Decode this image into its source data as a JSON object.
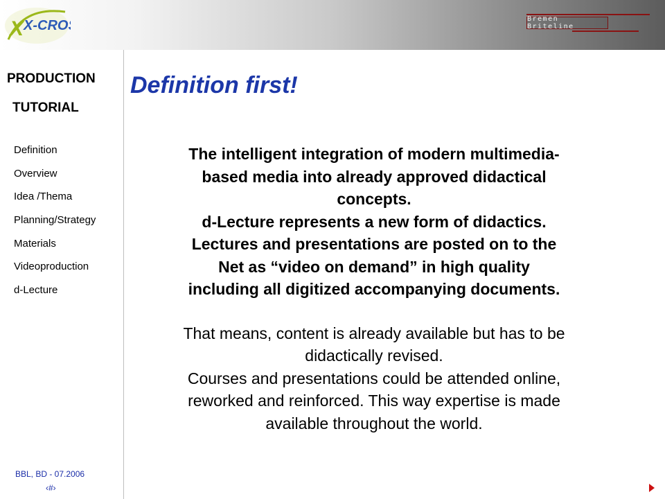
{
  "header": {
    "logo_text": "X-CROSS",
    "brand_text": "Bremen Briteline",
    "colors": {
      "logo_green": "#9bb81a",
      "logo_blue": "#2d5bb8",
      "brand_red": "#8a1212"
    }
  },
  "sidebar": {
    "title_line1": "PRODUCTION",
    "title_line2": "TUTORIAL",
    "items": [
      {
        "label": "Definition"
      },
      {
        "label": "Overview"
      },
      {
        "label": "Idea /Thema"
      },
      {
        "label": "Planning/Strategy"
      },
      {
        "label": "Materials"
      },
      {
        "label": "Videoproduction"
      },
      {
        "label": "d-Lecture"
      }
    ],
    "footer_credit": "BBL, BD - 07.2006",
    "page_number": "‹#›"
  },
  "slide": {
    "title": "Definition first!",
    "title_color": "#1c37a8",
    "bold_lines": [
      "The intelligent integration of modern multimedia-",
      "based media into already approved didactical",
      "concepts.",
      "d-Lecture represents a new form of didactics.",
      "Lectures and presentations are posted on to the",
      "Net as “video on demand” in high quality",
      "including all digitized accompanying documents."
    ],
    "normal_lines": [
      "That means, content is already available but has to be",
      "didactically revised.",
      "Courses and presentations could be attended online,",
      "reworked and reinforced. This way expertise is made",
      "available throughout the world."
    ]
  },
  "navigation": {
    "next_icon": "triangle-right-icon",
    "next_color": "#cc1111"
  }
}
